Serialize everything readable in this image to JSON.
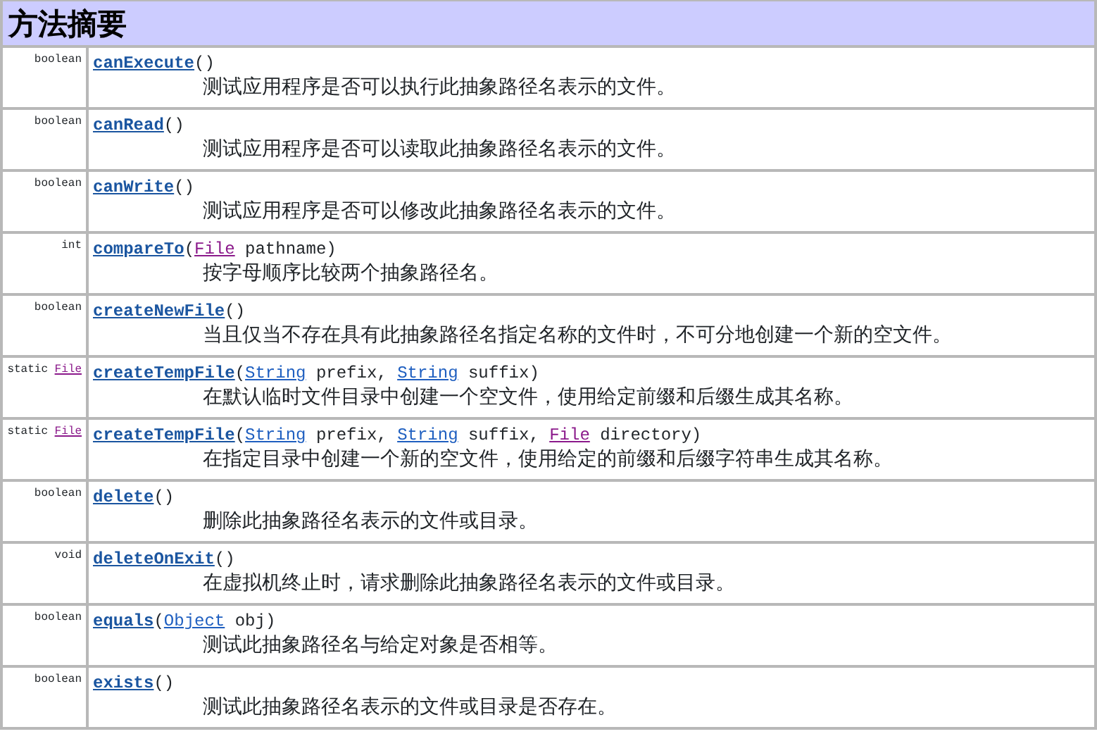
{
  "title": "方法摘要",
  "methods": [
    {
      "returns": {
        "modifier": "boolean"
      },
      "signature": [
        {
          "kind": "method",
          "text": "canExecute"
        },
        {
          "kind": "text",
          "text": "()"
        }
      ],
      "description": "测试应用程序是否可以执行此抽象路径名表示的文件。"
    },
    {
      "returns": {
        "modifier": "boolean"
      },
      "signature": [
        {
          "kind": "method",
          "text": "canRead"
        },
        {
          "kind": "text",
          "text": "()"
        }
      ],
      "description": "测试应用程序是否可以读取此抽象路径名表示的文件。"
    },
    {
      "returns": {
        "modifier": "boolean"
      },
      "signature": [
        {
          "kind": "method",
          "text": "canWrite"
        },
        {
          "kind": "text",
          "text": "()"
        }
      ],
      "description": "测试应用程序是否可以修改此抽象路径名表示的文件。"
    },
    {
      "returns": {
        "modifier": "int"
      },
      "signature": [
        {
          "kind": "method",
          "text": "compareTo"
        },
        {
          "kind": "text",
          "text": "("
        },
        {
          "kind": "type",
          "text": "File",
          "visited": true
        },
        {
          "kind": "text",
          "text": " pathname)"
        }
      ],
      "description": "按字母顺序比较两个抽象路径名。"
    },
    {
      "returns": {
        "modifier": "boolean"
      },
      "signature": [
        {
          "kind": "method",
          "text": "createNewFile"
        },
        {
          "kind": "text",
          "text": "()"
        }
      ],
      "description": "当且仅当不存在具有此抽象路径名指定名称的文件时，不可分地创建一个新的空文件。"
    },
    {
      "returns": {
        "modifier": "static",
        "type": "File",
        "visited": true
      },
      "signature": [
        {
          "kind": "method",
          "text": "createTempFile"
        },
        {
          "kind": "text",
          "text": "("
        },
        {
          "kind": "type",
          "text": "String",
          "visited": false
        },
        {
          "kind": "text",
          "text": " prefix, "
        },
        {
          "kind": "type",
          "text": "String",
          "visited": false
        },
        {
          "kind": "text",
          "text": " suffix)"
        }
      ],
      "description": "在默认临时文件目录中创建一个空文件，使用给定前缀和后缀生成其名称。"
    },
    {
      "returns": {
        "modifier": "static",
        "type": "File",
        "visited": true
      },
      "signature": [
        {
          "kind": "method",
          "text": "createTempFile"
        },
        {
          "kind": "text",
          "text": "("
        },
        {
          "kind": "type",
          "text": "String",
          "visited": false
        },
        {
          "kind": "text",
          "text": " prefix, "
        },
        {
          "kind": "type",
          "text": "String",
          "visited": false
        },
        {
          "kind": "text",
          "text": " suffix, "
        },
        {
          "kind": "type",
          "text": "File",
          "visited": true
        },
        {
          "kind": "text",
          "text": " directory)"
        }
      ],
      "description": "在指定目录中创建一个新的空文件，使用给定的前缀和后缀字符串生成其名称。"
    },
    {
      "returns": {
        "modifier": "boolean"
      },
      "signature": [
        {
          "kind": "method",
          "text": "delete"
        },
        {
          "kind": "text",
          "text": "()"
        }
      ],
      "description": "删除此抽象路径名表示的文件或目录。"
    },
    {
      "returns": {
        "modifier": "void"
      },
      "signature": [
        {
          "kind": "method",
          "text": "deleteOnExit"
        },
        {
          "kind": "text",
          "text": "()"
        }
      ],
      "description": "在虚拟机终止时，请求删除此抽象路径名表示的文件或目录。"
    },
    {
      "returns": {
        "modifier": "boolean"
      },
      "signature": [
        {
          "kind": "method",
          "text": "equals"
        },
        {
          "kind": "text",
          "text": "("
        },
        {
          "kind": "type",
          "text": "Object",
          "visited": false
        },
        {
          "kind": "text",
          "text": " obj)"
        }
      ],
      "description": "测试此抽象路径名与给定对象是否相等。"
    },
    {
      "returns": {
        "modifier": "boolean"
      },
      "signature": [
        {
          "kind": "method",
          "text": "exists"
        },
        {
          "kind": "text",
          "text": "()"
        }
      ],
      "description": "测试此抽象路径名表示的文件或目录是否存在。"
    }
  ]
}
